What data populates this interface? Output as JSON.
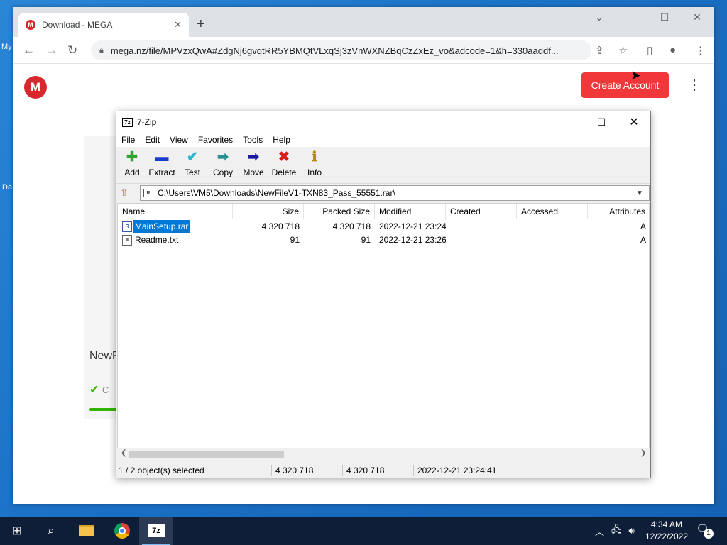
{
  "desktop": {
    "label_1": "My",
    "label_2": "Da"
  },
  "browser": {
    "tab_title": "Download - MEGA",
    "url": "mega.nz/file/MPVzxQwA#ZdgNj6gvqtRR5YBMQtVLxqSj3zVnWXNZBqCzZxEz_vo&adcode=1&h=330aaddf...",
    "icons": [
      "back-icon",
      "forward-icon",
      "reload-icon",
      "lock-icon",
      "share-icon",
      "star-icon",
      "sidepanel-icon",
      "profile-icon",
      "menu-icon"
    ]
  },
  "mega": {
    "logo": "M",
    "create_account": "Create Account",
    "file_name_partial": "NewF",
    "status_partial": "C"
  },
  "zip": {
    "title": "7-Zip",
    "app_icon": "7z",
    "menu": [
      "File",
      "Edit",
      "View",
      "Favorites",
      "Tools",
      "Help"
    ],
    "toolbar": [
      {
        "label": "Add",
        "icon": "add-icon",
        "glyph": "✚",
        "color": "#2ea52e"
      },
      {
        "label": "Extract",
        "icon": "extract-icon",
        "glyph": "▬",
        "color": "#1a3ccc"
      },
      {
        "label": "Test",
        "icon": "test-icon",
        "glyph": "✔",
        "color": "#2bb3c9"
      },
      {
        "label": "Copy",
        "icon": "copy-icon",
        "glyph": "➡",
        "color": "#2a8f8f"
      },
      {
        "label": "Move",
        "icon": "move-icon",
        "glyph": "➡",
        "color": "#1a1a9c"
      },
      {
        "label": "Delete",
        "icon": "delete-icon",
        "glyph": "✖",
        "color": "#d61c1c"
      },
      {
        "label": "Info",
        "icon": "info-icon",
        "glyph": "ℹ",
        "color": "#b58b00"
      }
    ],
    "path": "C:\\Users\\VM5\\Downloads\\NewFileV1-TXN83_Pass_55551.rar\\",
    "columns": [
      "Name",
      "Size",
      "Packed Size",
      "Modified",
      "Created",
      "Accessed",
      "Attributes"
    ],
    "rows": [
      {
        "name": "MainSetup.rar",
        "size": "4 320 718",
        "packed": "4 320 718",
        "modified": "2022-12-21 23:24",
        "created": "",
        "accessed": "",
        "attr": "A",
        "type": "rar",
        "selected": true
      },
      {
        "name": "Readme.txt",
        "size": "91",
        "packed": "91",
        "modified": "2022-12-21 23:26",
        "created": "",
        "accessed": "",
        "attr": "A",
        "type": "txt",
        "selected": false
      }
    ],
    "status": {
      "selection": "1 / 2 object(s) selected",
      "size": "4 320 718",
      "packed": "4 320 718",
      "modified": "2022-12-21 23:24:41"
    }
  },
  "taskbar": {
    "time": "4:34 AM",
    "date": "12/22/2022",
    "notifications": "1",
    "zip_label": "7z"
  }
}
